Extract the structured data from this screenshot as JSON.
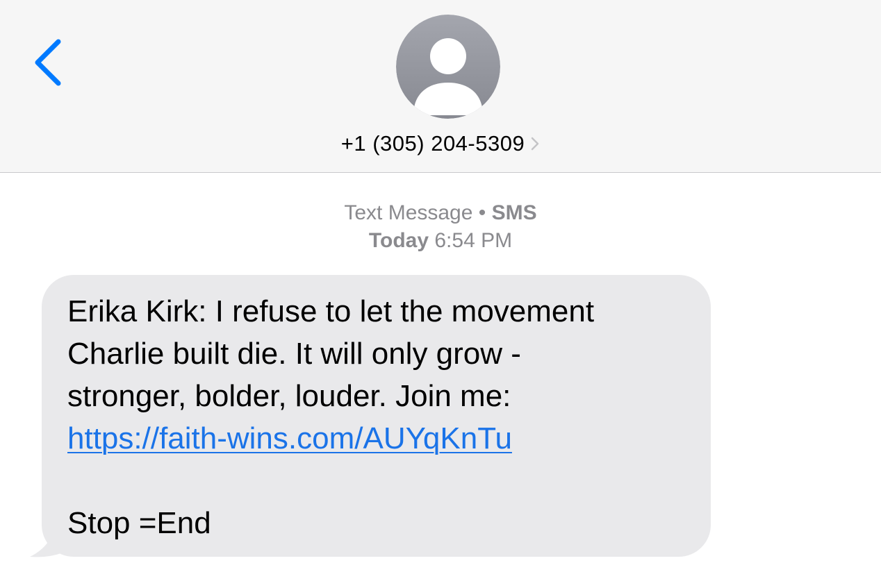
{
  "header": {
    "contact_name": "+1 (305) 204-5309"
  },
  "thread_meta": {
    "type_label": "Text Message",
    "separator": "•",
    "service": "SMS",
    "day": "Today",
    "time": "6:54 PM"
  },
  "message": {
    "lines": [
      "Erika Kirk: I refuse to let the movement",
      "Charlie built die. It will only grow -",
      "stronger, bolder, louder. Join me:"
    ],
    "link": "https://faith-wins.com/AUYqKnTu",
    "footer": "Stop =End"
  },
  "icons": {
    "back": "chevron-left-icon",
    "avatar": "person-silhouette-icon",
    "contact_details": "chevron-right-icon"
  },
  "colors": {
    "accent": "#007aff",
    "link": "#1a73e8",
    "bubble": "#e9e9eb",
    "header_bg": "#f6f6f6",
    "meta_text": "#8a8a8e",
    "avatar_gradient_top": "#a4a6ae",
    "avatar_gradient_bottom": "#878991"
  }
}
